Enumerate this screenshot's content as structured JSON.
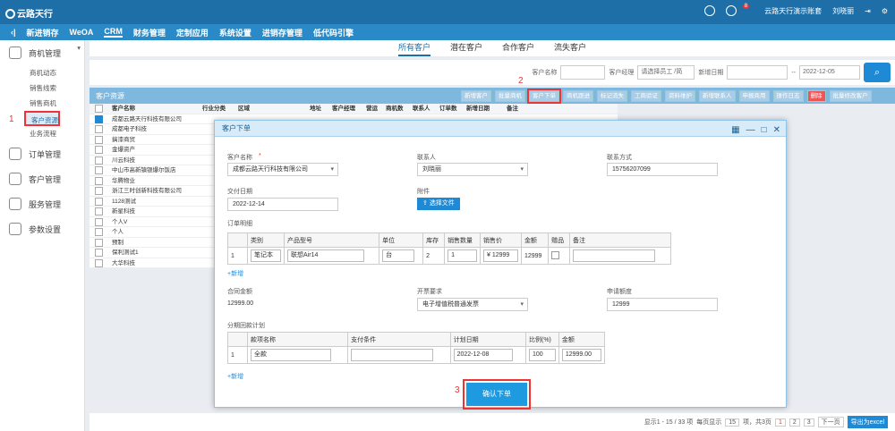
{
  "app": {
    "logo": "云路天行",
    "home_label": "云路天行演示账套",
    "user": "刘晓丽",
    "notif_count": "8"
  },
  "nav": {
    "items": [
      "新进销存",
      "WeOA",
      "CRM",
      "财务管理",
      "定制应用",
      "系统设置",
      "进销存管理",
      "低代码引擎"
    ],
    "active": "CRM"
  },
  "sidebar": {
    "groups": [
      {
        "label": "商机管理"
      },
      {
        "label": "订单管理"
      },
      {
        "label": "客户管理"
      },
      {
        "label": "服务管理"
      },
      {
        "label": "参数设置"
      }
    ],
    "subs": [
      "商机动态",
      "销售线索",
      "销售商机",
      "客户资源",
      "业务流程"
    ],
    "selected": "客户资源"
  },
  "tabs": [
    "所有客户",
    "潜在客户",
    "合作客户",
    "流失客户"
  ],
  "filter": {
    "cust_name": "客户名称",
    "manager": "客户经理",
    "manager_ph": "请选择员工 /简",
    "date_label": "新增日期",
    "date_to": "2022-12-05"
  },
  "toolbar": {
    "title": "客户资源",
    "buttons": [
      "新增客户",
      "批量商机",
      "客户下单",
      "商机跟进",
      "标记流失",
      "工商验证",
      "资料维护",
      "新增联系人",
      "申报商用",
      "操作日志",
      "删除",
      "批量修改客户"
    ]
  },
  "grid": {
    "headers": [
      "客户名称",
      "行业分类",
      "区域",
      "地址",
      "客户经理",
      "营运",
      "商机数",
      "联系人",
      "订单数",
      "新增日期",
      "备注"
    ],
    "rows": [
      "成都云路天行科技有限公司",
      "成都电子科技",
      "搞漆商贸",
      "金爆资产",
      "川云科技",
      "中山市高新镇银爆尔饭店",
      "华腾物业",
      "浙江三时创新科技有限公司",
      "1128测试",
      "新星科技",
      "个人V",
      "个人",
      "预制",
      "保利测试1",
      "大华科技"
    ]
  },
  "footer": {
    "info": "显示1 - 15 / 33 项",
    "per_page_label": "每页显示",
    "per_page": "15",
    "total_pages": "项，共3页",
    "pages": [
      "1",
      "2",
      "3"
    ],
    "next": "下一页",
    "export": "导出为excel"
  },
  "modal": {
    "title": "客户下单",
    "customer_label": "客户名称",
    "customer": "成都云路天行科技有限公司",
    "contact_label": "联系人",
    "contact": "刘晓丽",
    "phone_label": "联系方式",
    "phone": "15756207099",
    "delivery_label": "交付日期",
    "delivery": "2022-12-14",
    "attach_label": "附件",
    "attach_btn": "选择文件",
    "items_label": "订单明细",
    "items_headers": [
      "类别",
      "产品型号",
      "单位",
      "库存",
      "销售数量",
      "销售价",
      "金额",
      "赠品",
      "备注"
    ],
    "item": {
      "idx": "1",
      "cat": "笔记本",
      "model": "联想Air14",
      "unit": "台",
      "stock": "2",
      "qty": "1",
      "price": "12999",
      "amount": "12999"
    },
    "add": "新增",
    "contract_label": "合同金额",
    "contract": "12999.00",
    "invoice_label": "开票要求",
    "invoice": "电子增值税普通发票",
    "quota_label": "申请额度",
    "quota": "12999",
    "pay_label": "分期回款计划",
    "pay_headers": [
      "款项名称",
      "支付条件",
      "计划日期",
      "比例(%)",
      "金额"
    ],
    "pay": {
      "idx": "1",
      "name": "全款",
      "date": "2022-12-08",
      "ratio": "100",
      "amount": "12999.00"
    },
    "confirm": "确认下单"
  },
  "steps": [
    "1",
    "2",
    "3"
  ]
}
